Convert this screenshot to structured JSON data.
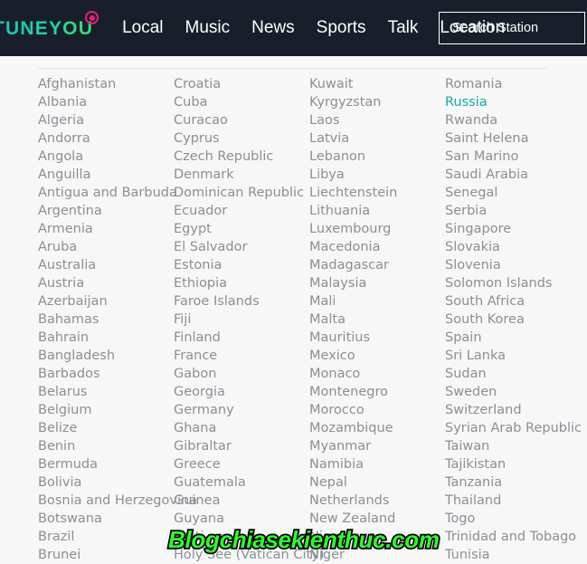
{
  "header": {
    "logo": {
      "text": "TUNEYOU",
      "dot_color": "#ec1e79",
      "gradient_start": "#19bfbf",
      "gradient_end": "#34e07a"
    },
    "background_color": "#181f2a",
    "nav_items": [
      {
        "label": "Local"
      },
      {
        "label": "Music"
      },
      {
        "label": "News"
      },
      {
        "label": "Sports"
      },
      {
        "label": "Talk"
      },
      {
        "label": "Location"
      }
    ],
    "search": {
      "placeholder": "Search Station",
      "value": "",
      "icon": "search-icon"
    }
  },
  "main": {
    "background_color": "#f7f7f7",
    "text_color": "#8a8f96",
    "active_color": "#17a8a8",
    "active_country": "Russia",
    "columns": [
      {
        "index": 0,
        "countries": [
          "Afghanistan",
          "Albania",
          "Algeria",
          "Andorra",
          "Angola",
          "Anguilla",
          "Antigua and Barbuda",
          "Argentina",
          "Armenia",
          "Aruba",
          "Australia",
          "Austria",
          "Azerbaijan",
          "Bahamas",
          "Bahrain",
          "Bangladesh",
          "Barbados",
          "Belarus",
          "Belgium",
          "Belize",
          "Benin",
          "Bermuda",
          "Bolivia",
          "Bosnia and Herzegovina",
          "Botswana",
          "Brazil",
          "Brunei"
        ]
      },
      {
        "index": 1,
        "countries": [
          "Croatia",
          "Cuba",
          "Curacao",
          "Cyprus",
          "Czech Republic",
          "Denmark",
          "Dominican Republic",
          "Ecuador",
          "Egypt",
          "El Salvador",
          "Estonia",
          "Ethiopia",
          "Faroe Islands",
          "Fiji",
          "Finland",
          "France",
          "Gabon",
          "Georgia",
          "Germany",
          "Ghana",
          "Gibraltar",
          "Greece",
          "Guatemala",
          "Guinea",
          "Guyana",
          "Haiti",
          "Holy See (Vatican City)"
        ]
      },
      {
        "index": 2,
        "countries": [
          "Kuwait",
          "Kyrgyzstan",
          "Laos",
          "Latvia",
          "Lebanon",
          "Libya",
          "Liechtenstein",
          "Lithuania",
          "Luxembourg",
          "Macedonia",
          "Madagascar",
          "Malaysia",
          "Mali",
          "Malta",
          "Mauritius",
          "Mexico",
          "Monaco",
          "Montenegro",
          "Morocco",
          "Mozambique",
          "Myanmar",
          "Namibia",
          "Nepal",
          "Netherlands",
          "New Zealand",
          "Nicaragua",
          "Niger"
        ]
      },
      {
        "index": 3,
        "countries": [
          "Romania",
          "Russia",
          "Rwanda",
          "Saint Helena",
          "San Marino",
          "Saudi Arabia",
          "Senegal",
          "Serbia",
          "Singapore",
          "Slovakia",
          "Slovenia",
          "Solomon Islands",
          "South Africa",
          "South Korea",
          "Spain",
          "Sri Lanka",
          "Sudan",
          "Sweden",
          "Switzerland",
          "Syrian Arab Republic",
          "Taiwan",
          "Tajikistan",
          "Tanzania",
          "Thailand",
          "Togo",
          "Trinidad and Tobago",
          "Tunisia"
        ]
      }
    ]
  },
  "watermark": {
    "text": "Blogchiasekienthuc.com",
    "color": "#2dfb2d",
    "outline_color": "#000000"
  }
}
